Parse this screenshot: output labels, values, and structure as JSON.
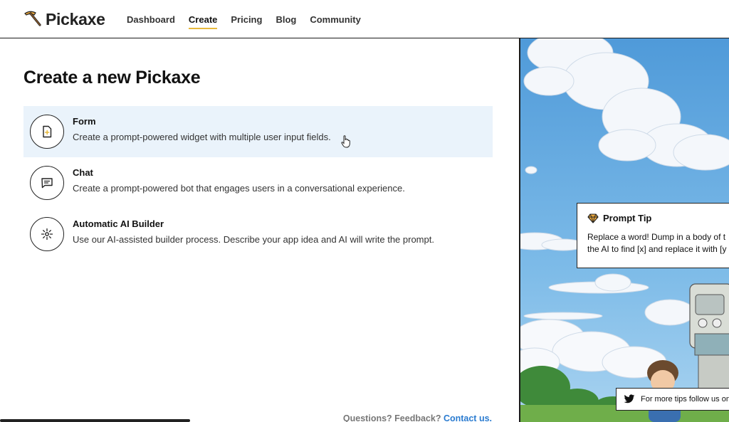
{
  "header": {
    "logo_text": "Pickaxe",
    "nav": [
      {
        "label": "Dashboard",
        "active": false
      },
      {
        "label": "Create",
        "active": true
      },
      {
        "label": "Pricing",
        "active": false
      },
      {
        "label": "Blog",
        "active": false
      },
      {
        "label": "Community",
        "active": false
      }
    ]
  },
  "main": {
    "title": "Create a new Pickaxe",
    "options": [
      {
        "title": "Form",
        "description": "Create a prompt-powered widget with multiple user input fields.",
        "icon": "document-plus-icon",
        "hovered": true
      },
      {
        "title": "Chat",
        "description": "Create a prompt-powered bot that engages users in a conversational experience.",
        "icon": "chat-bubble-icon",
        "hovered": false
      },
      {
        "title": "Automatic AI Builder",
        "description": "Use our AI-assisted builder process. Describe your app idea and AI will write the prompt.",
        "icon": "sparkle-icon",
        "hovered": false
      }
    ],
    "footer_question": "Questions? Feedback? ",
    "footer_link": "Contact us."
  },
  "tip": {
    "title": "Prompt Tip",
    "line1": "Replace a word! Dump in a body of t",
    "line2": "the AI to find [x] and replace it with [y",
    "twitter_text": "For more tips follow us on"
  },
  "colors": {
    "accent_underline": "#e8b93b",
    "hover_bg": "#eaf3fb",
    "link": "#2a7bd0",
    "sky": "#6aaee0"
  }
}
